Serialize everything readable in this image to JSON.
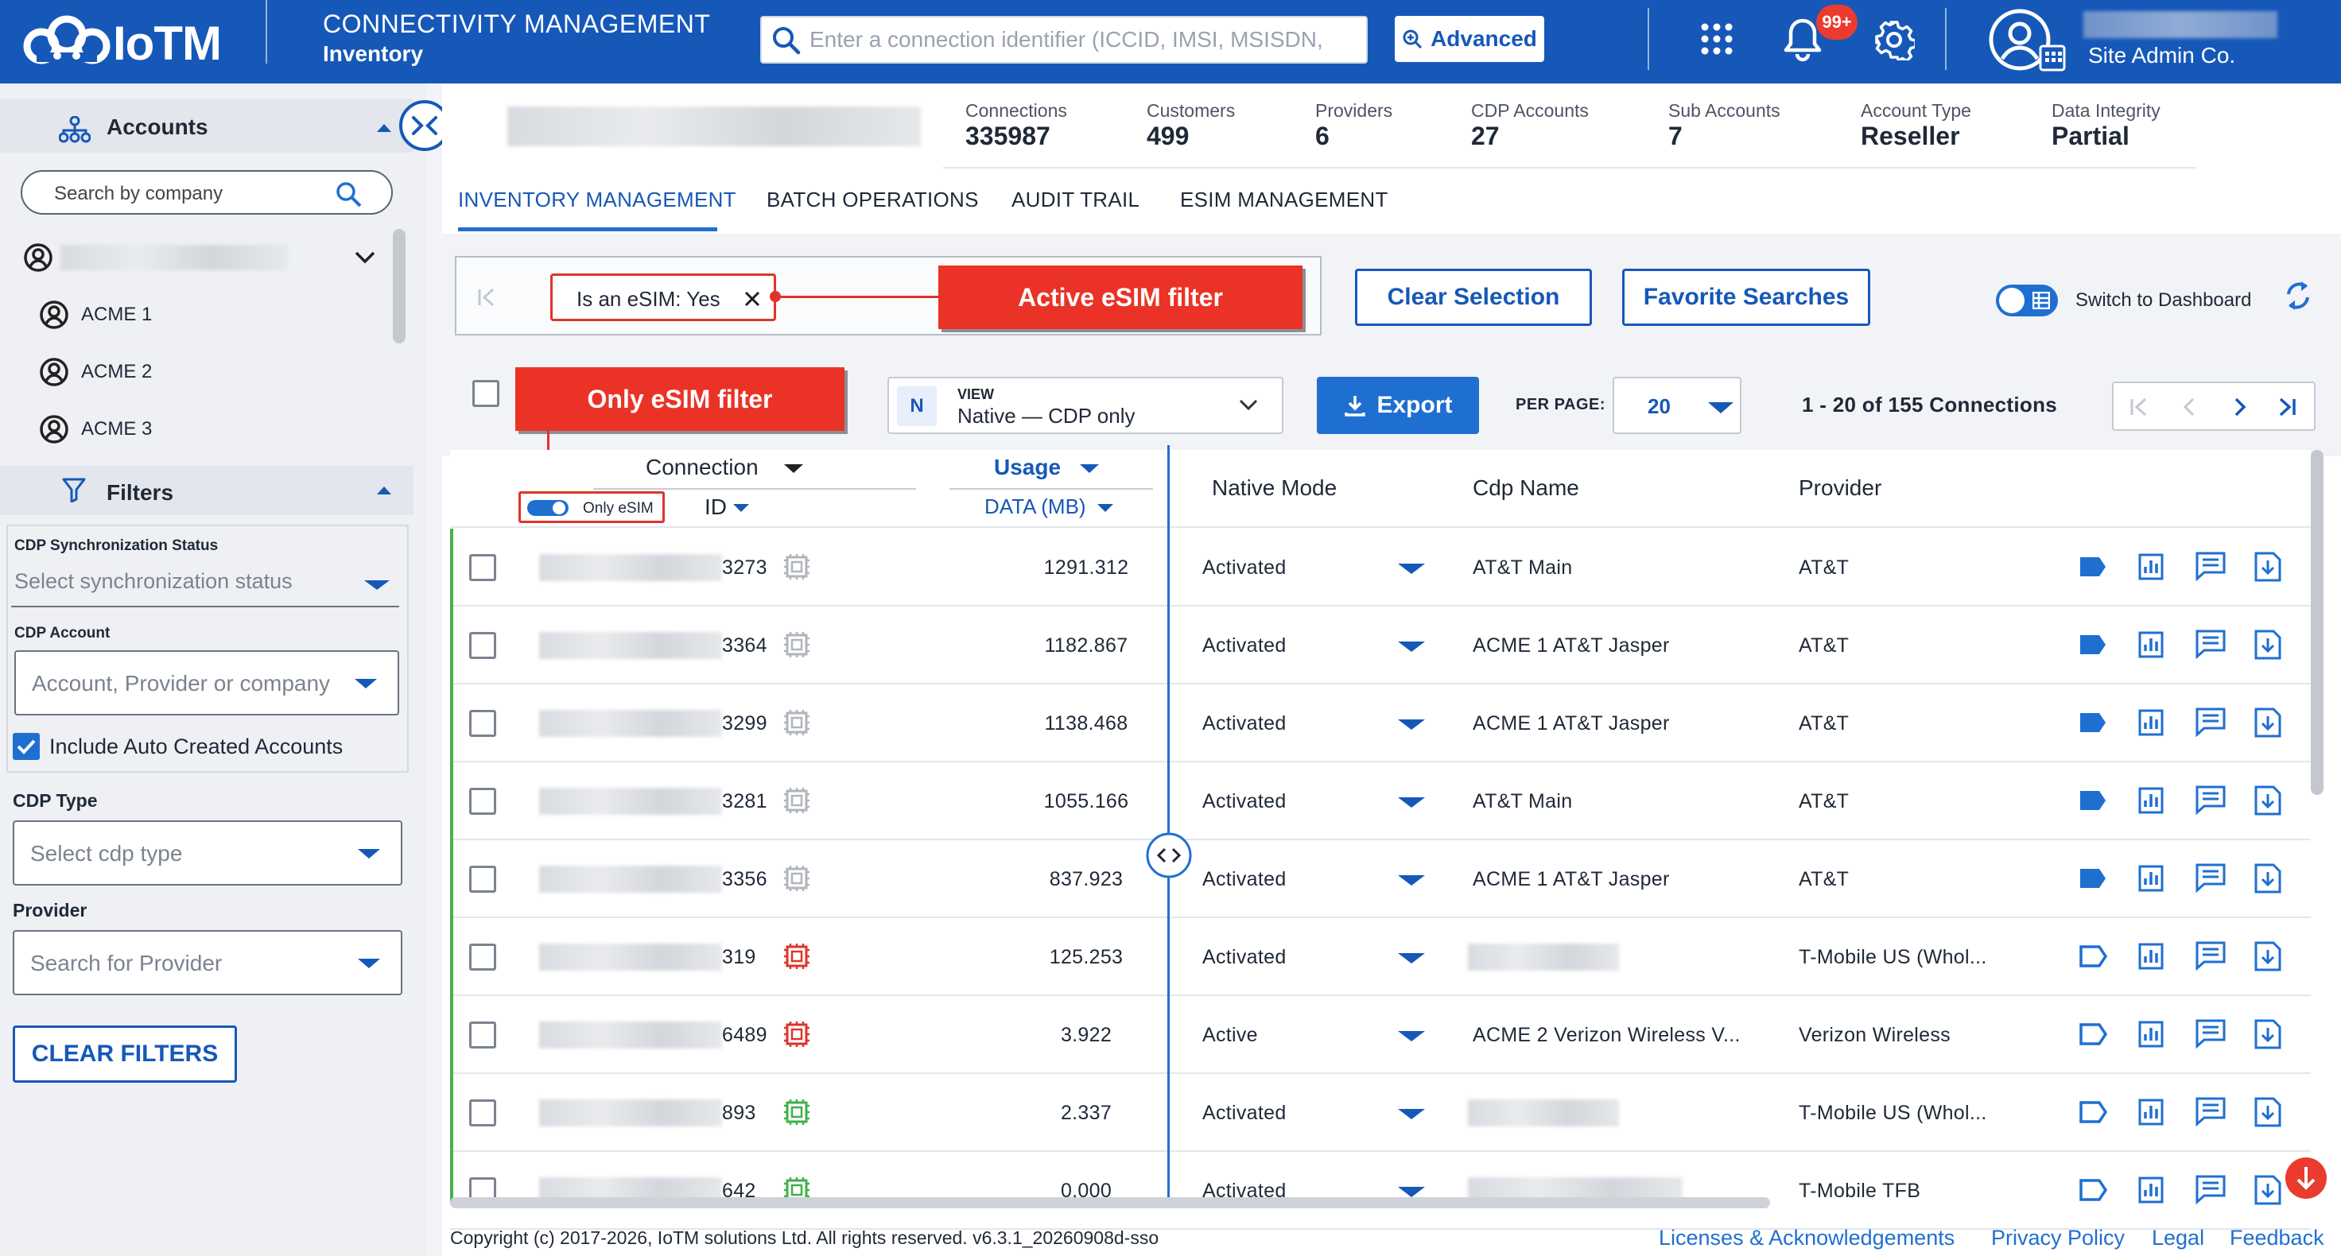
{
  "header": {
    "logo": "IoTM",
    "module_title": "CONNECTIVITY MANAGEMENT",
    "module_sub": "Inventory",
    "search_placeholder": "Enter a connection identifier (ICCID, IMSI, MSISDN,",
    "advanced_label": "Advanced",
    "notifications_badge": "99+",
    "user_company": "Site Admin Co."
  },
  "sidebar": {
    "accounts_title": "Accounts",
    "search_placeholder": "Search by company",
    "accounts": [
      "ACME 1",
      "ACME 2",
      "ACME 3"
    ],
    "filters_title": "Filters",
    "cdp_sync_label": "CDP Synchronization Status",
    "cdp_sync_placeholder": "Select synchronization status",
    "cdp_account_label": "CDP Account",
    "cdp_account_placeholder": "Account, Provider or company",
    "include_auto_label": "Include Auto Created Accounts",
    "include_auto_checked": true,
    "cdp_type_label": "CDP Type",
    "cdp_type_placeholder": "Select cdp type",
    "provider_label": "Provider",
    "provider_placeholder": "Search for Provider",
    "clear_filters": "CLEAR FILTERS"
  },
  "stats": [
    {
      "label": "Connections",
      "value": "335987"
    },
    {
      "label": "Customers",
      "value": "499"
    },
    {
      "label": "Providers",
      "value": "6"
    },
    {
      "label": "CDP Accounts",
      "value": "27"
    },
    {
      "label": "Sub Accounts",
      "value": "7"
    },
    {
      "label": "Account Type",
      "value": "Reseller"
    },
    {
      "label": "Data Integrity",
      "value": "Partial"
    }
  ],
  "tabs": [
    "INVENTORY MANAGEMENT",
    "BATCH OPERATIONS",
    "AUDIT TRAIL",
    "ESIM MANAGEMENT"
  ],
  "toolbar": {
    "chip_label": "Is an eSIM: Yes",
    "callout_active": "Active eSIM filter",
    "callout_only": "Only eSIM filter",
    "clear_selection": "Clear Selection",
    "favorite_searches": "Favorite Searches",
    "switch_dashboard": "Switch to Dashboard",
    "view_label": "VIEW",
    "view_badge": "N",
    "view_value": "Native — CDP only",
    "export": "Export",
    "per_page_label": "PER PAGE:",
    "per_page_value": "20",
    "range_text": "1 - 20 of 155 Connections"
  },
  "table": {
    "col_connection": "Connection",
    "col_id": "ID",
    "only_esim": "Only eSIM",
    "col_usage": "Usage",
    "col_data": "DATA (MB)",
    "col_native": "Native Mode",
    "col_cdp": "Cdp Name",
    "col_provider": "Provider",
    "rows": [
      {
        "id": "3273",
        "chip": "gray",
        "usage": "1291.312",
        "mode": "Activated",
        "cdp": "AT&T Main",
        "provider": "AT&T",
        "tag": "filled"
      },
      {
        "id": "3364",
        "chip": "gray",
        "usage": "1182.867",
        "mode": "Activated",
        "cdp": "ACME 1 AT&T Jasper",
        "provider": "AT&T",
        "tag": "filled"
      },
      {
        "id": "3299",
        "chip": "gray",
        "usage": "1138.468",
        "mode": "Activated",
        "cdp": "ACME 1 AT&T Jasper",
        "provider": "AT&T",
        "tag": "filled"
      },
      {
        "id": "3281",
        "chip": "gray",
        "usage": "1055.166",
        "mode": "Activated",
        "cdp": "AT&T Main",
        "provider": "AT&T",
        "tag": "filled"
      },
      {
        "id": "3356",
        "chip": "gray",
        "usage": "837.923",
        "mode": "Activated",
        "cdp": "ACME 1 AT&T Jasper",
        "provider": "AT&T",
        "tag": "filled"
      },
      {
        "id": "319",
        "chip": "red",
        "usage": "125.253",
        "mode": "Activated",
        "cdp": "",
        "provider": "T-Mobile US (Whol...",
        "tag": "outline"
      },
      {
        "id": "6489",
        "chip": "red",
        "usage": "3.922",
        "mode": "Active",
        "cdp": "ACME 2 Verizon Wireless V...",
        "provider": "Verizon Wireless",
        "tag": "outline"
      },
      {
        "id": "893",
        "chip": "green",
        "usage": "2.337",
        "mode": "Activated",
        "cdp": "",
        "provider": "T-Mobile US (Whol...",
        "tag": "outline"
      },
      {
        "id": "642",
        "chip": "green",
        "usage": "0.000",
        "mode": "Activated",
        "cdp": "",
        "provider": "T-Mobile TFB",
        "tag": "outline"
      }
    ]
  },
  "footer": {
    "copyright": "Copyright (c) 2017-2026, IoTM solutions Ltd. All rights reserved. v6.3.1_20260908d-sso",
    "links": [
      "Licenses & Acknowledgements",
      "Privacy Policy",
      "Legal",
      "Feedback"
    ]
  },
  "colors": {
    "primary": "#1658b8",
    "accent": "#1f6fd1",
    "callout": "#ea3326",
    "green": "#4caf50"
  }
}
